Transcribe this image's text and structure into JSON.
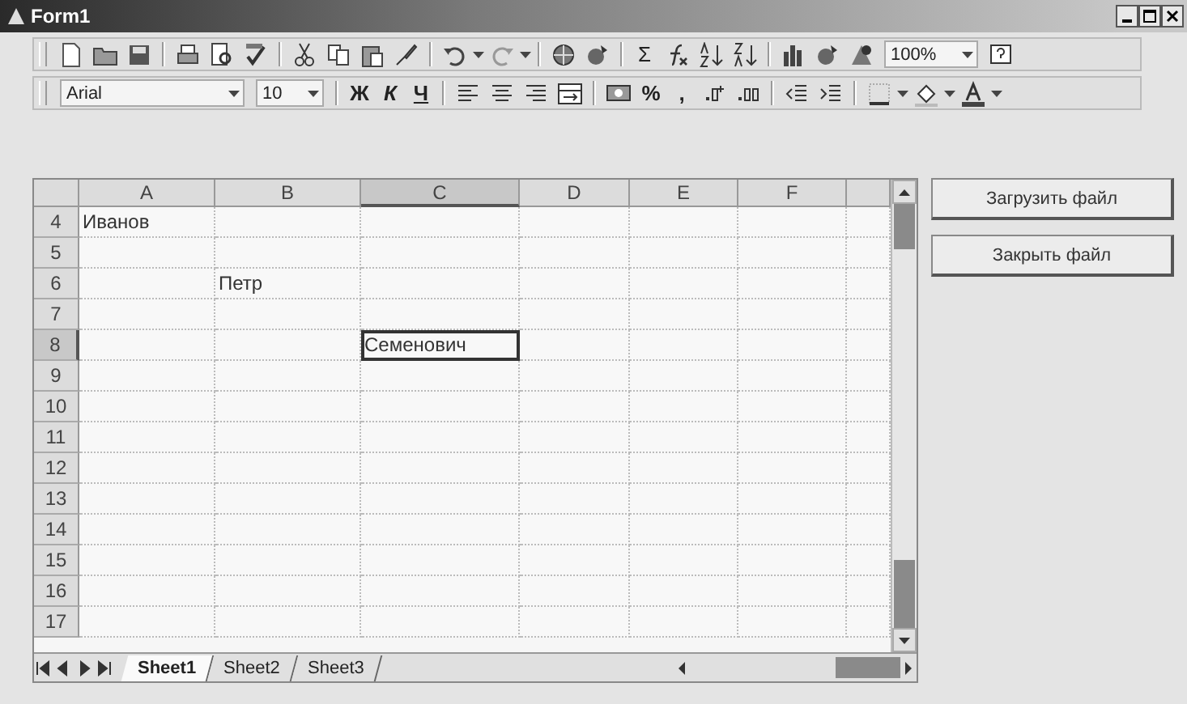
{
  "window": {
    "title": "Form1"
  },
  "standard_toolbar": {
    "sum": "Σ",
    "zoom": "100%"
  },
  "formatting_toolbar": {
    "font": "Arial",
    "size": "10",
    "bold": "Ж",
    "italic": "К",
    "underline": "Ч",
    "percent": "%",
    "comma": ","
  },
  "grid": {
    "columns": [
      {
        "label": "A",
        "selected": false
      },
      {
        "label": "B",
        "selected": false
      },
      {
        "label": "C",
        "selected": true
      },
      {
        "label": "D",
        "selected": false
      },
      {
        "label": "E",
        "selected": false
      },
      {
        "label": "F",
        "selected": false
      }
    ],
    "rows": [
      {
        "label": "4",
        "selected": false,
        "cells": [
          {
            "text": "Иванов",
            "selected": false
          }
        ]
      },
      {
        "label": "5",
        "selected": false
      },
      {
        "label": "6",
        "selected": false,
        "cells": [
          {
            "text": "",
            "selected": false
          },
          {
            "text": "Петр",
            "selected": false
          }
        ]
      },
      {
        "label": "7",
        "selected": false
      },
      {
        "label": "8",
        "selected": true,
        "cells": [
          {
            "text": "",
            "selected": false
          },
          {
            "text": "",
            "selected": false
          },
          {
            "text": "Семенович",
            "selected": true
          }
        ]
      },
      {
        "label": "9",
        "selected": false
      },
      {
        "label": "10",
        "selected": false
      },
      {
        "label": "11",
        "selected": false
      },
      {
        "label": "12",
        "selected": false
      },
      {
        "label": "13",
        "selected": false
      },
      {
        "label": "14",
        "selected": false
      },
      {
        "label": "15",
        "selected": false
      },
      {
        "label": "16",
        "selected": false
      },
      {
        "label": "17",
        "selected": false
      }
    ]
  },
  "sheet_tabs": [
    {
      "label": "Sheet1",
      "selected": true
    },
    {
      "label": "Sheet2",
      "selected": false
    },
    {
      "label": "Sheet3",
      "selected": false
    }
  ],
  "buttons": [
    "Загрузить файл",
    "Закрыть файл"
  ]
}
